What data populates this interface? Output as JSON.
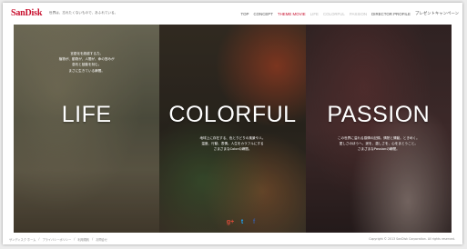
{
  "header": {
    "logo": "SanDisk",
    "tagline": "世界は、忘れたくないもので、あふれている。",
    "nav": [
      "TOP",
      "CONCEPT",
      "THEME MOVIE",
      "LIFE",
      "COLORFUL",
      "PASSION",
      "DIRECTOR PROFILE",
      "プレゼントキャンペーン"
    ]
  },
  "panels": [
    {
      "title": "LIFE",
      "caption": "言語化を超越する力。\n植物が、動物が、人間が、命の営みが\n息吹と鼓動を刻む。\nまさに生きている瞬間。"
    },
    {
      "title": "COLORFUL",
      "caption": "地球上に存在する、色とりどりの風景や人。\n温度、行動、表情。人生をカラフルにする\nさまざまなColorの瞬間。"
    },
    {
      "title": "PASSION",
      "caption": "この世界に溢れる感情の記録。情熱と情動。ときめく。\n愛しさのほうへ、涙を、激しさを、心をまとうこと。\nさまざまなPassionの瞬間。"
    }
  ],
  "social": {
    "gplus": "g+",
    "twitter": "t",
    "facebook": "f"
  },
  "footer": {
    "links": [
      "サンディスク ホーム",
      "プライバシーポリシー",
      "利用規約",
      "お問合せ"
    ],
    "copyright": "Copyright © 2013 SanDisk Corporation. All rights reserved."
  },
  "colors": {
    "brand": "#c8102e",
    "active_nav": "#c8102e"
  }
}
